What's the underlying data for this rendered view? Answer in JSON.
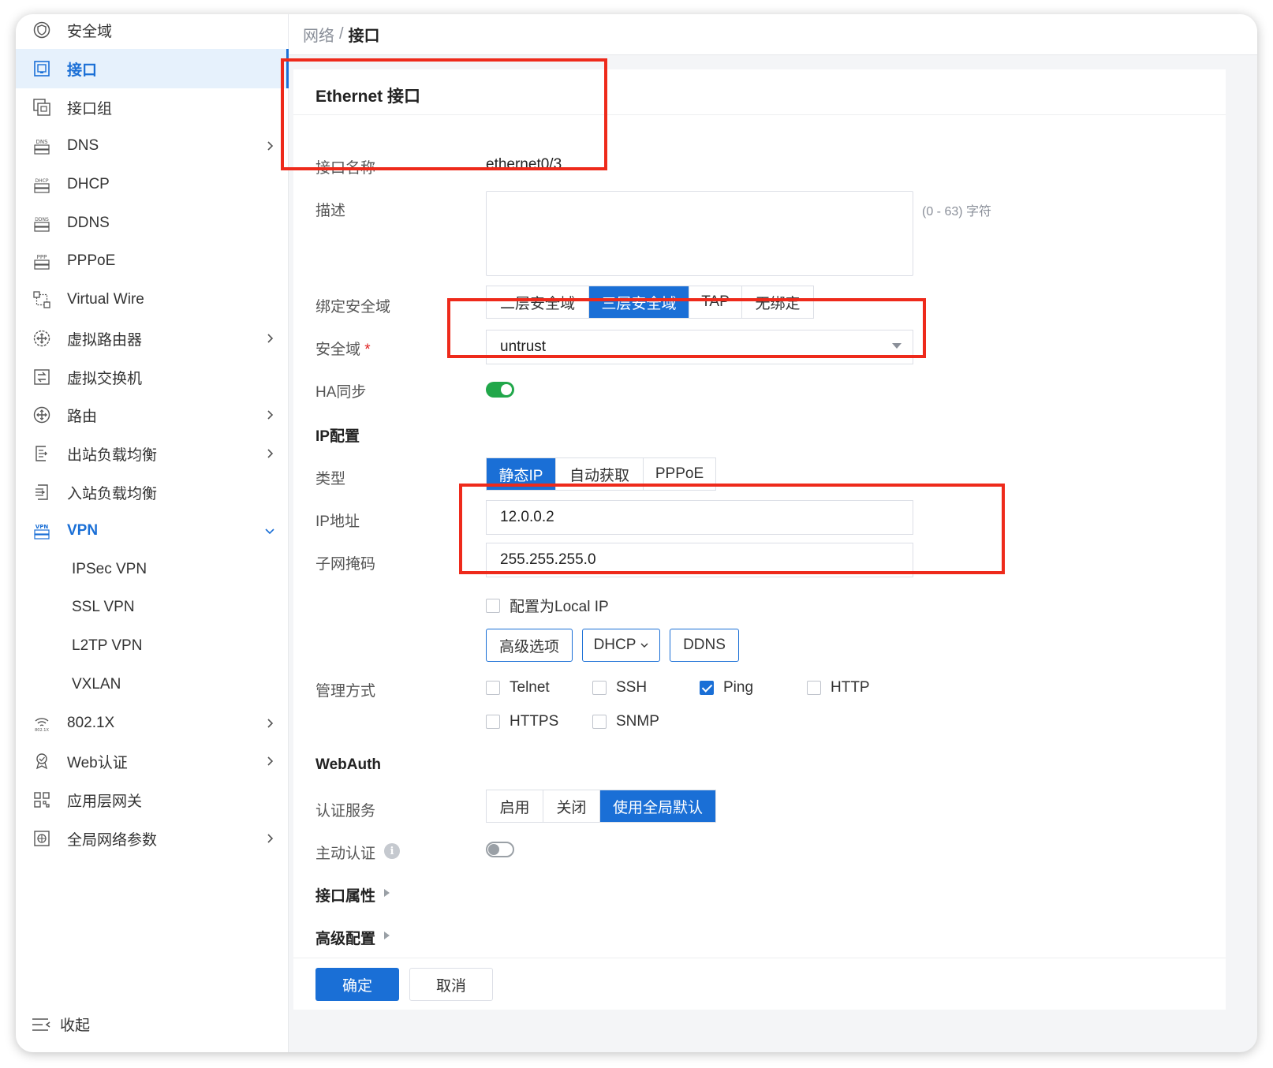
{
  "breadcrumb": {
    "parent": "网络",
    "separator": "/",
    "current": "接口"
  },
  "sidebar": {
    "items": [
      {
        "label": "安全域",
        "icon": "shield-icon"
      },
      {
        "label": "接口",
        "icon": "interface-icon",
        "active": true
      },
      {
        "label": "接口组",
        "icon": "interface-group-icon"
      },
      {
        "label": "DNS",
        "icon": "dns-icon",
        "expandable": true
      },
      {
        "label": "DHCP",
        "icon": "dhcp-icon"
      },
      {
        "label": "DDNS",
        "icon": "ddns-icon"
      },
      {
        "label": "PPPoE",
        "icon": "pppoe-icon"
      },
      {
        "label": "Virtual Wire",
        "icon": "virtual-wire-icon"
      },
      {
        "label": "虚拟路由器",
        "icon": "virtual-router-icon",
        "expandable": true
      },
      {
        "label": "虚拟交换机",
        "icon": "virtual-switch-icon"
      },
      {
        "label": "路由",
        "icon": "route-icon",
        "expandable": true
      },
      {
        "label": "出站负载均衡",
        "icon": "outbound-lb-icon",
        "expandable": true
      },
      {
        "label": "入站负载均衡",
        "icon": "inbound-lb-icon"
      },
      {
        "label": "VPN",
        "icon": "vpn-icon",
        "expanded": true
      },
      {
        "label": "IPSec VPN",
        "sub": true
      },
      {
        "label": "SSL VPN",
        "sub": true
      },
      {
        "label": "L2TP VPN",
        "sub": true
      },
      {
        "label": "VXLAN",
        "sub": true
      },
      {
        "label": "802.1X",
        "icon": "wifi-8021x-icon",
        "expandable": true
      },
      {
        "label": "Web认证",
        "icon": "web-auth-icon",
        "expandable": true
      },
      {
        "label": "应用层网关",
        "icon": "app-gateway-icon"
      },
      {
        "label": "全局网络参数",
        "icon": "global-params-icon",
        "expandable": true
      }
    ],
    "collapse_label": "收起"
  },
  "form": {
    "title": "Ethernet 接口",
    "name_label": "接口名称",
    "name_value": "ethernet0/3",
    "desc_label": "描述",
    "desc_hint": "(0 - 63) 字符",
    "bind_label": "绑定安全域",
    "bind_options": [
      "二层安全域",
      "三层安全域",
      "TAP",
      "无绑定"
    ],
    "bind_selected": "三层安全域",
    "zone_label": "安全域",
    "zone_required": "*",
    "zone_value": "untrust",
    "ha_label": "HA同步",
    "ha_on": true,
    "ip_section": "IP配置",
    "type_label": "类型",
    "type_options": [
      "静态IP",
      "自动获取",
      "PPPoE"
    ],
    "type_selected": "静态IP",
    "ip_label": "IP地址",
    "ip_value": "12.0.0.2",
    "mask_label": "子网掩码",
    "mask_value": "255.255.255.0",
    "local_ip_label": "配置为Local IP",
    "buttons": {
      "advanced": "高级选项",
      "dhcp": "DHCP",
      "ddns": "DDNS"
    },
    "mgmt_label": "管理方式",
    "mgmt_options": [
      {
        "label": "Telnet",
        "checked": false
      },
      {
        "label": "SSH",
        "checked": false
      },
      {
        "label": "Ping",
        "checked": true
      },
      {
        "label": "HTTP",
        "checked": false
      },
      {
        "label": "HTTPS",
        "checked": false
      },
      {
        "label": "SNMP",
        "checked": false
      }
    ],
    "webauth_section": "WebAuth",
    "auth_label": "认证服务",
    "auth_options": [
      "启用",
      "关闭",
      "使用全局默认"
    ],
    "auth_selected": "使用全局默认",
    "active_auth_label": "主动认证",
    "active_auth_on": false,
    "iface_attr_label": "接口属性",
    "adv_config_label": "高级配置"
  },
  "footer": {
    "ok": "确定",
    "cancel": "取消"
  },
  "colors": {
    "accent": "#1a6fd6",
    "toggle_on": "#21a74a",
    "highlight": "#ee2a1b"
  }
}
